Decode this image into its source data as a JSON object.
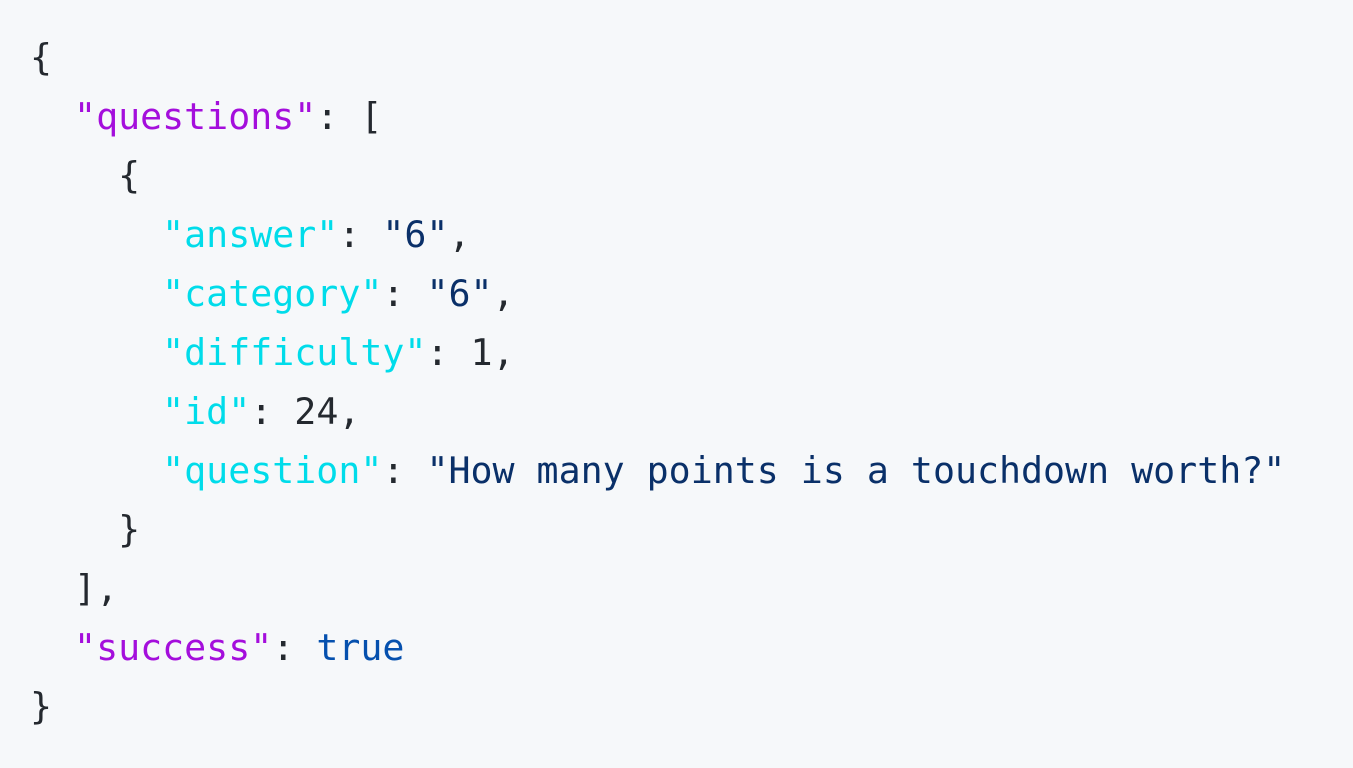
{
  "code": {
    "open_brace": "{",
    "questions_key": "\"questions\"",
    "colon": ":",
    "open_bracket": "[",
    "item_open_brace": "{",
    "fields": [
      {
        "key": "\"answer\"",
        "value": "\"6\"",
        "suffix": ","
      },
      {
        "key": "\"category\"",
        "value": "\"6\"",
        "suffix": ","
      },
      {
        "key": "\"difficulty\"",
        "value": "1",
        "suffix": ","
      },
      {
        "key": "\"id\"",
        "value": "24",
        "suffix": ","
      },
      {
        "key": "\"question\"",
        "value": "\"How many points is a touchdown worth?\"",
        "suffix": ""
      }
    ],
    "item_close_brace": "}",
    "close_bracket": "],",
    "success_key": "\"success\"",
    "success_value": "true",
    "close_brace": "}"
  },
  "colors": {
    "background": "#f6f8fa",
    "top_key": "#a40edc",
    "nested_key": "#00dcea",
    "string": "#0a3069",
    "boolean": "#0550ae",
    "text": "#24292f"
  }
}
